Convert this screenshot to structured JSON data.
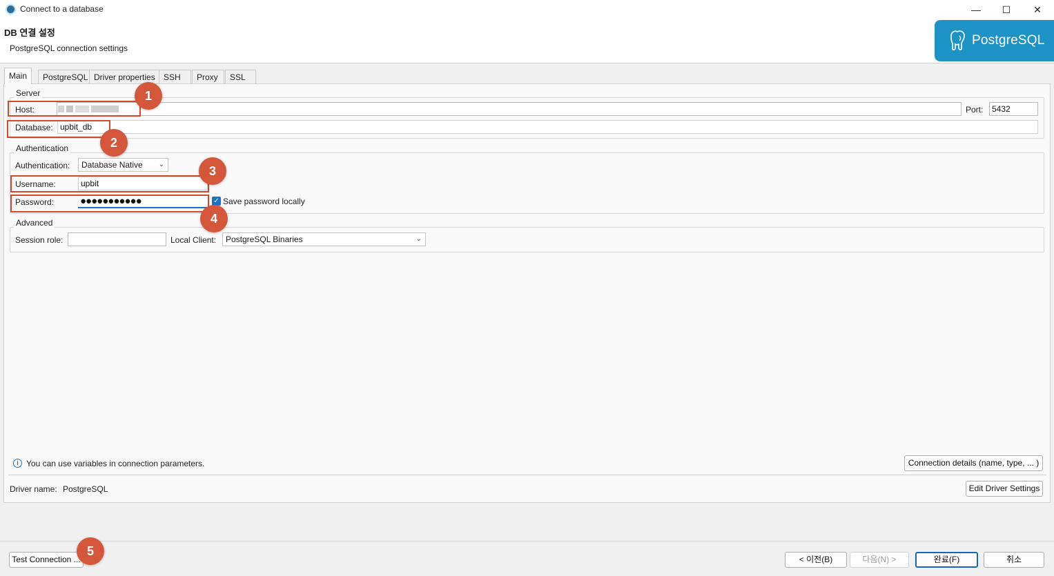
{
  "window": {
    "title": "Connect to a database",
    "minimize": "—",
    "maximize": "☐",
    "close": "✕"
  },
  "header": {
    "title": "DB 연결 설정",
    "subtitle": "PostgreSQL connection settings",
    "logo_text": "PostgreSQL"
  },
  "tabs": [
    {
      "label": "Main",
      "active": true
    },
    {
      "label": "PostgreSQL"
    },
    {
      "label": "Driver properties"
    },
    {
      "label": "SSH"
    },
    {
      "label": "Proxy"
    },
    {
      "label": "SSL"
    }
  ],
  "server": {
    "group_title": "Server",
    "host_label": "Host:",
    "host_value": "",
    "port_label": "Port:",
    "port_value": "5432",
    "database_label": "Database:",
    "database_value": "upbit_db"
  },
  "authentication": {
    "group_title": "Authentication",
    "auth_label": "Authentication:",
    "auth_value": "Database Native",
    "username_label": "Username:",
    "username_value": "upbit",
    "password_label": "Password:",
    "password_value": "●●●●●●●●●●●",
    "save_password_label": "Save password locally",
    "save_password_checked": true
  },
  "advanced": {
    "group_title": "Advanced",
    "session_role_label": "Session role:",
    "session_role_value": "",
    "local_client_label": "Local Client:",
    "local_client_value": "PostgreSQL Binaries"
  },
  "info": {
    "text": "You can use variables in connection parameters.",
    "connection_details_button": "Connection details (name, type, ... )"
  },
  "driver": {
    "label": "Driver name:",
    "value": "PostgreSQL",
    "edit_button": "Edit Driver Settings"
  },
  "footer": {
    "test_connection": "Test Connection ...",
    "prev": "< 이전(B)",
    "next": "다음(N) >",
    "finish": "완료(F)",
    "cancel": "취소"
  },
  "annotations": [
    "1",
    "2",
    "3",
    "4",
    "5"
  ],
  "colors": {
    "accent_blue": "#1a73c9",
    "annotation_red": "#d24a2c",
    "postgres_banner": "#1f93c6"
  }
}
